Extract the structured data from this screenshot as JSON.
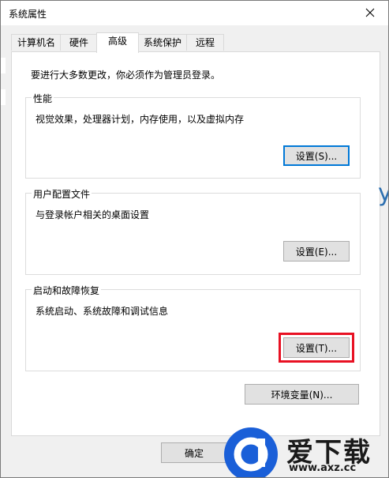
{
  "window": {
    "title": "系统属性"
  },
  "tabs": [
    {
      "label": "计算机名"
    },
    {
      "label": "硬件"
    },
    {
      "label": "高级"
    },
    {
      "label": "系统保护"
    },
    {
      "label": "远程"
    }
  ],
  "intro": "要进行大多数更改，你必须作为管理员登录。",
  "performance": {
    "title": "性能",
    "desc": "视觉效果，处理器计划，内存使用，以及虚拟内存",
    "button": "设置(S)..."
  },
  "profile": {
    "title": "用户配置文件",
    "desc": "与登录帐户相关的桌面设置",
    "button": "设置(E)..."
  },
  "startup": {
    "title": "启动和故障恢复",
    "desc": "系统启动、系统故障和调试信息",
    "button": "设置(T)..."
  },
  "env_button": "环境变量(N)...",
  "ok_button": "确定",
  "watermark": {
    "brand": "爱下载",
    "url": "www.axz.cc"
  },
  "background": {
    "edge_glyph": "ys"
  },
  "colors": {
    "focus": "#0078d7",
    "highlight": "#e81123",
    "watermark_blue": "#1a5fd8"
  }
}
